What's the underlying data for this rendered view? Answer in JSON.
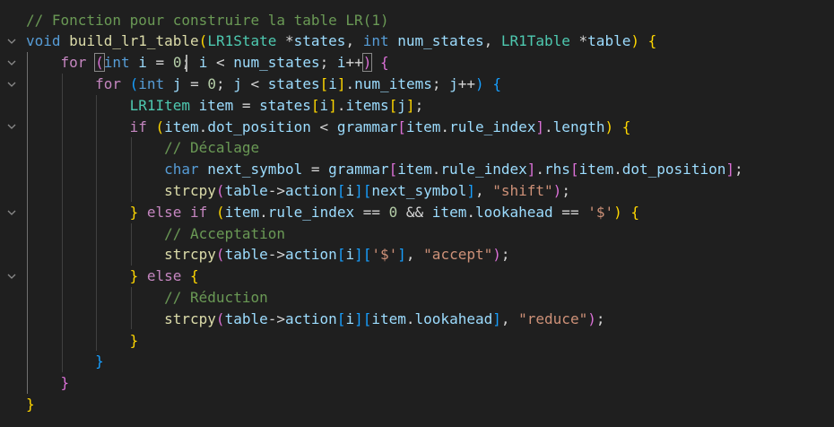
{
  "editor": {
    "language": "c",
    "colors": {
      "background": "#1f1f1f",
      "comment": "#6a9955",
      "keyword": "#569cd6",
      "control": "#c586c0",
      "function": "#dcdcaa",
      "type": "#4ec9b0",
      "variable": "#9cdcfe",
      "number": "#b5cea8",
      "string": "#ce9178",
      "bracket1": "#ffd700",
      "bracket2": "#da70d6",
      "bracket3": "#179fff"
    },
    "lines": [
      {
        "fold": false,
        "indent": 0,
        "tokens": [
          [
            "// Fonction pour construire la table LR(1)",
            "comment"
          ]
        ]
      },
      {
        "fold": true,
        "indent": 0,
        "tokens": [
          [
            "void",
            "keyword"
          ],
          [
            " ",
            "op"
          ],
          [
            "build_lr1_table",
            "func"
          ],
          [
            "(",
            "b1"
          ],
          [
            "LR1State",
            "type"
          ],
          [
            " *",
            "op"
          ],
          [
            "states",
            "var"
          ],
          [
            ", ",
            "op"
          ],
          [
            "int",
            "keyword"
          ],
          [
            " ",
            "op"
          ],
          [
            "num_states",
            "var"
          ],
          [
            ", ",
            "op"
          ],
          [
            "LR1Table",
            "type"
          ],
          [
            " *",
            "op"
          ],
          [
            "table",
            "var"
          ],
          [
            ")",
            "b1"
          ],
          [
            " ",
            "op"
          ],
          [
            "{",
            "b1"
          ]
        ]
      },
      {
        "fold": true,
        "indent": 1,
        "tokens": [
          [
            "for",
            "control"
          ],
          [
            " ",
            "op"
          ],
          [
            "(",
            "b2",
            "box"
          ],
          [
            "int",
            "keyword"
          ],
          [
            " ",
            "op"
          ],
          [
            "i",
            "var"
          ],
          [
            " = ",
            "op"
          ],
          [
            "0",
            "num"
          ],
          [
            "; ",
            "op"
          ],
          [
            "i",
            "var"
          ],
          [
            " < ",
            "op"
          ],
          [
            "num_states",
            "var"
          ],
          [
            "; ",
            "op"
          ],
          [
            "i",
            "var"
          ],
          [
            "++",
            "op"
          ],
          [
            ")",
            "b2",
            "box"
          ],
          [
            " ",
            "op"
          ],
          [
            "{",
            "b2"
          ]
        ]
      },
      {
        "fold": true,
        "indent": 2,
        "tokens": [
          [
            "for",
            "control"
          ],
          [
            " ",
            "op"
          ],
          [
            "(",
            "b3"
          ],
          [
            "int",
            "keyword"
          ],
          [
            " ",
            "op"
          ],
          [
            "j",
            "var"
          ],
          [
            " = ",
            "op"
          ],
          [
            "0",
            "num"
          ],
          [
            "; ",
            "op"
          ],
          [
            "j",
            "var"
          ],
          [
            " < ",
            "op"
          ],
          [
            "states",
            "var"
          ],
          [
            "[",
            "b1"
          ],
          [
            "i",
            "var"
          ],
          [
            "]",
            "b1"
          ],
          [
            ".",
            "op"
          ],
          [
            "num_items",
            "var"
          ],
          [
            "; ",
            "op"
          ],
          [
            "j",
            "var"
          ],
          [
            "++",
            "op"
          ],
          [
            ")",
            "b3"
          ],
          [
            " ",
            "op"
          ],
          [
            "{",
            "b3"
          ]
        ]
      },
      {
        "fold": false,
        "indent": 3,
        "tokens": [
          [
            "LR1Item",
            "type"
          ],
          [
            " ",
            "op"
          ],
          [
            "item",
            "var"
          ],
          [
            " = ",
            "op"
          ],
          [
            "states",
            "var"
          ],
          [
            "[",
            "b1"
          ],
          [
            "i",
            "var"
          ],
          [
            "]",
            "b1"
          ],
          [
            ".",
            "op"
          ],
          [
            "items",
            "var"
          ],
          [
            "[",
            "b1"
          ],
          [
            "j",
            "var"
          ],
          [
            "]",
            "b1"
          ],
          [
            ";",
            "op"
          ]
        ]
      },
      {
        "fold": true,
        "indent": 3,
        "tokens": [
          [
            "if",
            "control"
          ],
          [
            " ",
            "op"
          ],
          [
            "(",
            "b1"
          ],
          [
            "item",
            "var"
          ],
          [
            ".",
            "op"
          ],
          [
            "dot_position",
            "var"
          ],
          [
            " < ",
            "op"
          ],
          [
            "grammar",
            "var"
          ],
          [
            "[",
            "b2"
          ],
          [
            "item",
            "var"
          ],
          [
            ".",
            "op"
          ],
          [
            "rule_index",
            "var"
          ],
          [
            "]",
            "b2"
          ],
          [
            ".",
            "op"
          ],
          [
            "length",
            "var"
          ],
          [
            ")",
            "b1"
          ],
          [
            " ",
            "op"
          ],
          [
            "{",
            "b1"
          ]
        ]
      },
      {
        "fold": false,
        "indent": 4,
        "tokens": [
          [
            "// Décalage",
            "comment"
          ]
        ]
      },
      {
        "fold": false,
        "indent": 4,
        "tokens": [
          [
            "char",
            "keyword"
          ],
          [
            " ",
            "op"
          ],
          [
            "next_symbol",
            "var"
          ],
          [
            " = ",
            "op"
          ],
          [
            "grammar",
            "var"
          ],
          [
            "[",
            "b2"
          ],
          [
            "item",
            "var"
          ],
          [
            ".",
            "op"
          ],
          [
            "rule_index",
            "var"
          ],
          [
            "]",
            "b2"
          ],
          [
            ".",
            "op"
          ],
          [
            "rhs",
            "var"
          ],
          [
            "[",
            "b2"
          ],
          [
            "item",
            "var"
          ],
          [
            ".",
            "op"
          ],
          [
            "dot_position",
            "var"
          ],
          [
            "]",
            "b2"
          ],
          [
            ";",
            "op"
          ]
        ]
      },
      {
        "fold": false,
        "indent": 4,
        "tokens": [
          [
            "strcpy",
            "func"
          ],
          [
            "(",
            "b2"
          ],
          [
            "table",
            "var"
          ],
          [
            "->",
            "op"
          ],
          [
            "action",
            "var"
          ],
          [
            "[",
            "b3"
          ],
          [
            "i",
            "var"
          ],
          [
            "]",
            "b3"
          ],
          [
            "[",
            "b3"
          ],
          [
            "next_symbol",
            "var"
          ],
          [
            "]",
            "b3"
          ],
          [
            ", ",
            "op"
          ],
          [
            "\"shift\"",
            "str"
          ],
          [
            ")",
            "b2"
          ],
          [
            ";",
            "op"
          ]
        ]
      },
      {
        "fold": true,
        "indent": 3,
        "tokens": [
          [
            "}",
            "b1"
          ],
          [
            " ",
            "op"
          ],
          [
            "else",
            "control"
          ],
          [
            " ",
            "op"
          ],
          [
            "if",
            "control"
          ],
          [
            " ",
            "op"
          ],
          [
            "(",
            "b1"
          ],
          [
            "item",
            "var"
          ],
          [
            ".",
            "op"
          ],
          [
            "rule_index",
            "var"
          ],
          [
            " == ",
            "op"
          ],
          [
            "0",
            "num"
          ],
          [
            " && ",
            "op"
          ],
          [
            "item",
            "var"
          ],
          [
            ".",
            "op"
          ],
          [
            "lookahead",
            "var"
          ],
          [
            " == ",
            "op"
          ],
          [
            "'$'",
            "str"
          ],
          [
            ")",
            "b1"
          ],
          [
            " ",
            "op"
          ],
          [
            "{",
            "b1"
          ]
        ]
      },
      {
        "fold": false,
        "indent": 4,
        "tokens": [
          [
            "// Acceptation",
            "comment"
          ]
        ]
      },
      {
        "fold": false,
        "indent": 4,
        "tokens": [
          [
            "strcpy",
            "func"
          ],
          [
            "(",
            "b2"
          ],
          [
            "table",
            "var"
          ],
          [
            "->",
            "op"
          ],
          [
            "action",
            "var"
          ],
          [
            "[",
            "b3"
          ],
          [
            "i",
            "var"
          ],
          [
            "]",
            "b3"
          ],
          [
            "[",
            "b3"
          ],
          [
            "'$'",
            "str"
          ],
          [
            "]",
            "b3"
          ],
          [
            ", ",
            "op"
          ],
          [
            "\"accept\"",
            "str"
          ],
          [
            ")",
            "b2"
          ],
          [
            ";",
            "op"
          ]
        ]
      },
      {
        "fold": true,
        "indent": 3,
        "tokens": [
          [
            "}",
            "b1"
          ],
          [
            " ",
            "op"
          ],
          [
            "else",
            "control"
          ],
          [
            " ",
            "op"
          ],
          [
            "{",
            "b1"
          ]
        ]
      },
      {
        "fold": false,
        "indent": 4,
        "tokens": [
          [
            "// Réduction",
            "comment"
          ]
        ]
      },
      {
        "fold": false,
        "indent": 4,
        "tokens": [
          [
            "strcpy",
            "func"
          ],
          [
            "(",
            "b2"
          ],
          [
            "table",
            "var"
          ],
          [
            "->",
            "op"
          ],
          [
            "action",
            "var"
          ],
          [
            "[",
            "b3"
          ],
          [
            "i",
            "var"
          ],
          [
            "]",
            "b3"
          ],
          [
            "[",
            "b3"
          ],
          [
            "item",
            "var"
          ],
          [
            ".",
            "op"
          ],
          [
            "lookahead",
            "var"
          ],
          [
            "]",
            "b3"
          ],
          [
            ", ",
            "op"
          ],
          [
            "\"reduce\"",
            "str"
          ],
          [
            ")",
            "b2"
          ],
          [
            ";",
            "op"
          ]
        ]
      },
      {
        "fold": false,
        "indent": 3,
        "tokens": [
          [
            "}",
            "b1"
          ]
        ]
      },
      {
        "fold": false,
        "indent": 2,
        "tokens": [
          [
            "}",
            "b3"
          ]
        ]
      },
      {
        "fold": false,
        "indent": 1,
        "tokens": [
          [
            "}",
            "b2"
          ]
        ]
      },
      {
        "fold": false,
        "indent": 0,
        "tokens": [
          [
            "}",
            "b1"
          ]
        ]
      }
    ]
  }
}
